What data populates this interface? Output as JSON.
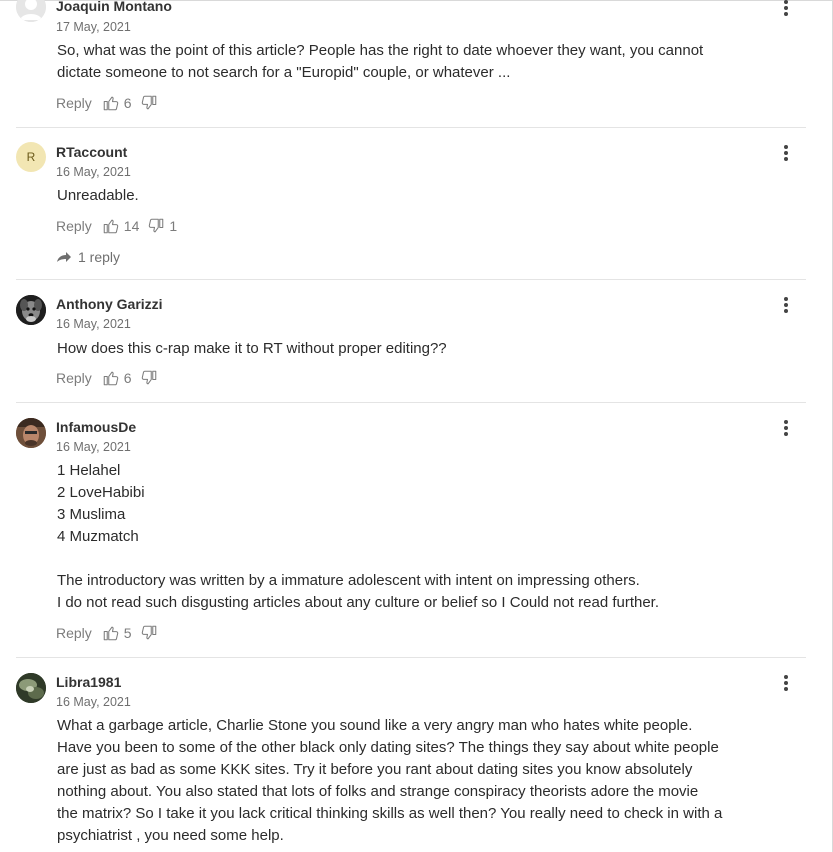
{
  "comments": [
    {
      "author": "Joaquin Montano",
      "date": "17 May, 2021",
      "avatar": "person-placeholder",
      "lines": [
        "So, what was the point of this article? People has the right to date whoever they want, you cannot",
        "dictate someone to not search for a \"Europid\" couple, or whatever ..."
      ],
      "reply_label": "Reply",
      "likes": "6",
      "dislikes": ""
    },
    {
      "author": "RTaccount",
      "date": "16 May, 2021",
      "avatar_letter": "R",
      "lines": [
        "Unreadable."
      ],
      "reply_label": "Reply",
      "likes": "14",
      "dislikes": "1",
      "replies_label": "1 reply"
    },
    {
      "author": "Anthony Garizzi",
      "date": "16 May, 2021",
      "avatar": "dog-photo",
      "lines": [
        "How does this c-rap make it to RT without proper editing??"
      ],
      "reply_label": "Reply",
      "likes": "6",
      "dislikes": ""
    },
    {
      "author": "InfamousDe",
      "date": "16 May, 2021",
      "avatar": "person-photo",
      "lines": [
        "1 Helahel",
        "2 LoveHabibi",
        "3 Muslima",
        "4 Muzmatch",
        "",
        "The introductory was written by a immature adolescent with intent on impressing others.",
        "I do not read such disgusting articles about any culture or belief so I Could not read further."
      ],
      "reply_label": "Reply",
      "likes": "5",
      "dislikes": ""
    },
    {
      "author": "Libra1981",
      "date": "16 May, 2021",
      "avatar": "landscape-photo",
      "lines": [
        "What a garbage article, Charlie Stone you sound like a very angry man who hates white people.",
        "Have you been to some of the other black only dating sites?  The things they say about white people",
        "are just as bad as some KKK sites. Try it before you rant about dating sites you know absolutely",
        "nothing about.  You also stated that lots of folks and strange conspiracy theorists adore the movie",
        "the matrix? So I take it you lack critical thinking skills as well then? You really need to check in with a",
        "psychiatrist , you need some help."
      ]
    }
  ]
}
